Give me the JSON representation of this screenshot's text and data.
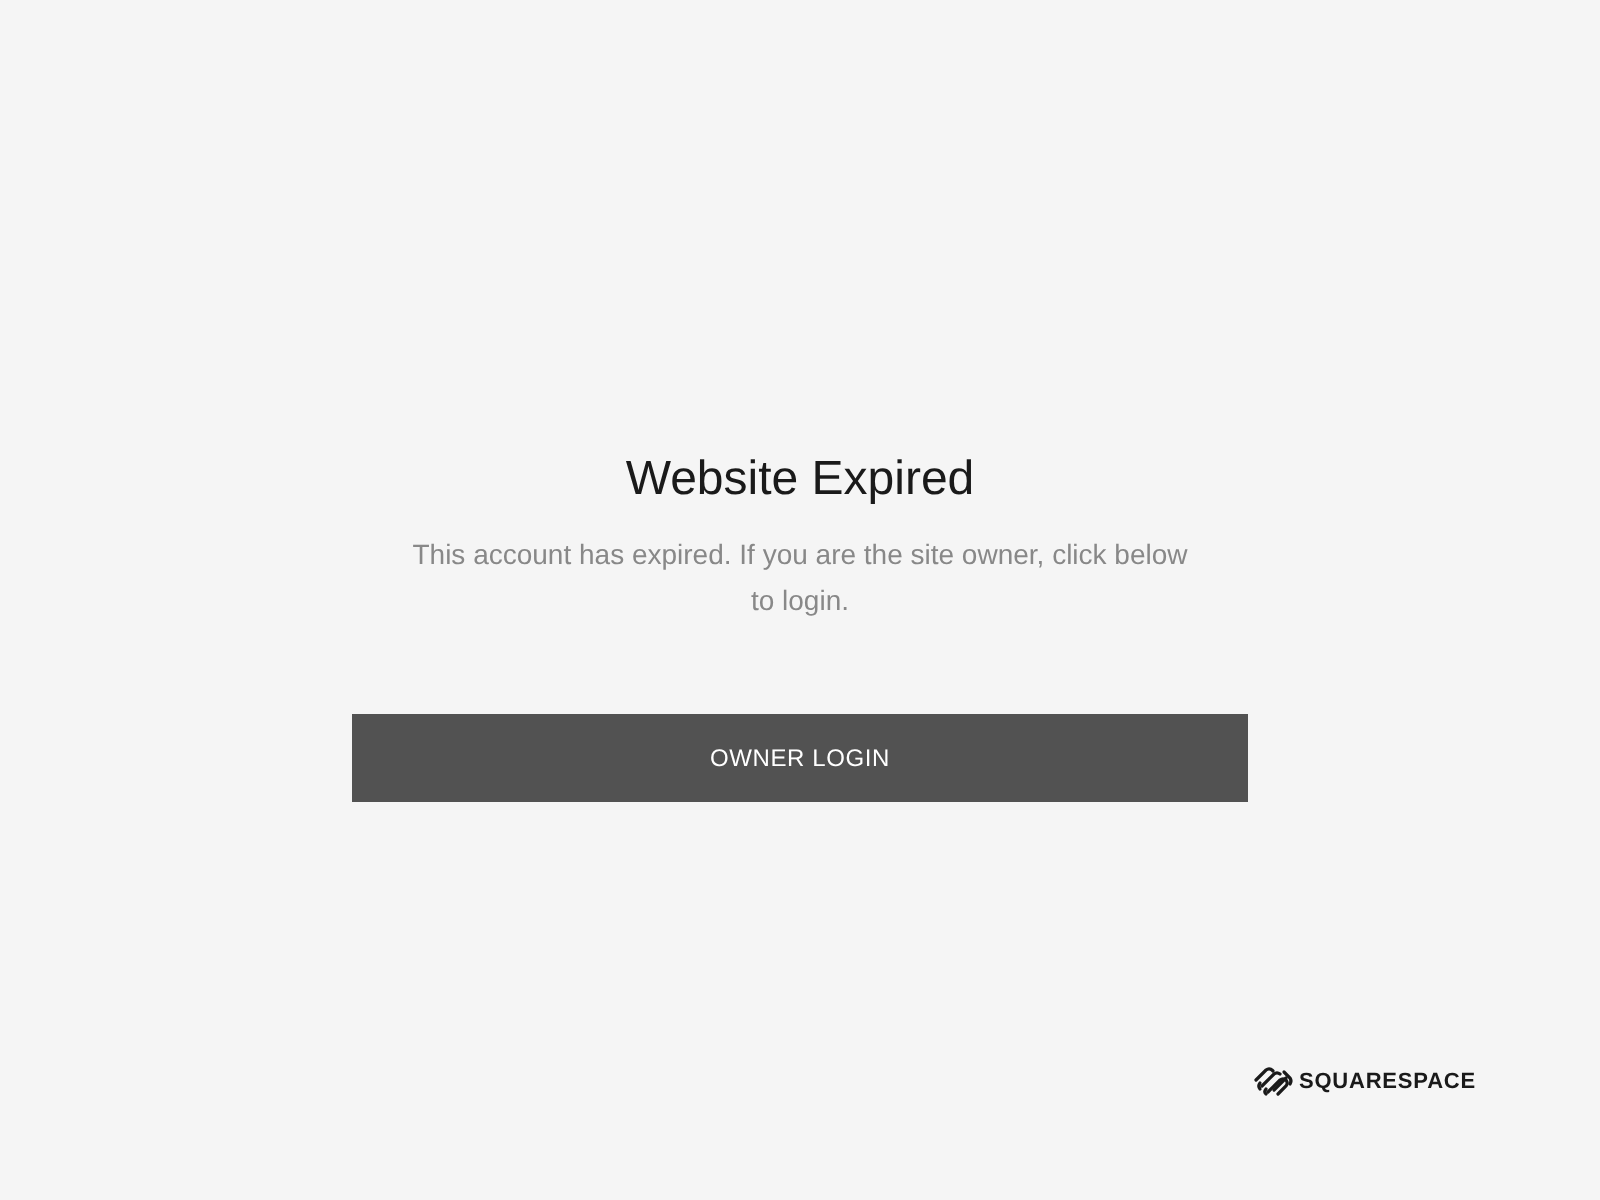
{
  "title": "Website Expired",
  "message": "This account has expired. If you are the site owner, click below to login.",
  "button": "OWNER LOGIN",
  "footer_logo": {
    "text": "SQUARESPACE"
  }
}
